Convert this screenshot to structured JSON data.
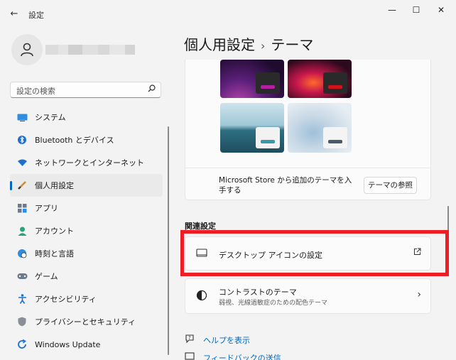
{
  "window": {
    "back_glyph": "←",
    "title": "設定",
    "minimize_glyph": "—",
    "maximize_glyph": "☐",
    "close_glyph": "✕"
  },
  "user": {
    "avatar_icon": "person-icon"
  },
  "search": {
    "placeholder": "設定の検索",
    "icon": "search-icon"
  },
  "sidebar": {
    "items": [
      {
        "label": "システム",
        "icon": "system-icon"
      },
      {
        "label": "Bluetooth とデバイス",
        "icon": "bluetooth-icon"
      },
      {
        "label": "ネットワークとインターネット",
        "icon": "wifi-icon"
      },
      {
        "label": "個人用設定",
        "icon": "brush-icon",
        "selected": true
      },
      {
        "label": "アプリ",
        "icon": "apps-icon"
      },
      {
        "label": "アカウント",
        "icon": "account-icon"
      },
      {
        "label": "時刻と言語",
        "icon": "globe-clock-icon"
      },
      {
        "label": "ゲーム",
        "icon": "gamepad-icon"
      },
      {
        "label": "アクセシビリティ",
        "icon": "accessibility-icon"
      },
      {
        "label": "プライバシーとセキュリティ",
        "icon": "shield-icon"
      },
      {
        "label": "Windows Update",
        "icon": "update-icon"
      }
    ]
  },
  "header": {
    "parent": "個人用設定",
    "separator": "›",
    "current": "テーマ"
  },
  "themes": {
    "store_text": "Microsoft Store から追加のテーマを入手する",
    "browse_button": "テーマの参照"
  },
  "related": {
    "heading": "関連設定",
    "desktop_icons": {
      "label": "デスクトップ アイコンの設定",
      "trailing_icon": "open-external-icon"
    },
    "contrast": {
      "label": "コントラストのテーマ",
      "sublabel": "弱視、光線過敏症のための配色テーマ",
      "trailing_icon": "chevron-right-icon"
    }
  },
  "links": {
    "help": "ヘルプを表示",
    "feedback": "フィードバックの送信"
  },
  "colors": {
    "accent": "#0067c0",
    "highlight": "#ee1c24"
  }
}
